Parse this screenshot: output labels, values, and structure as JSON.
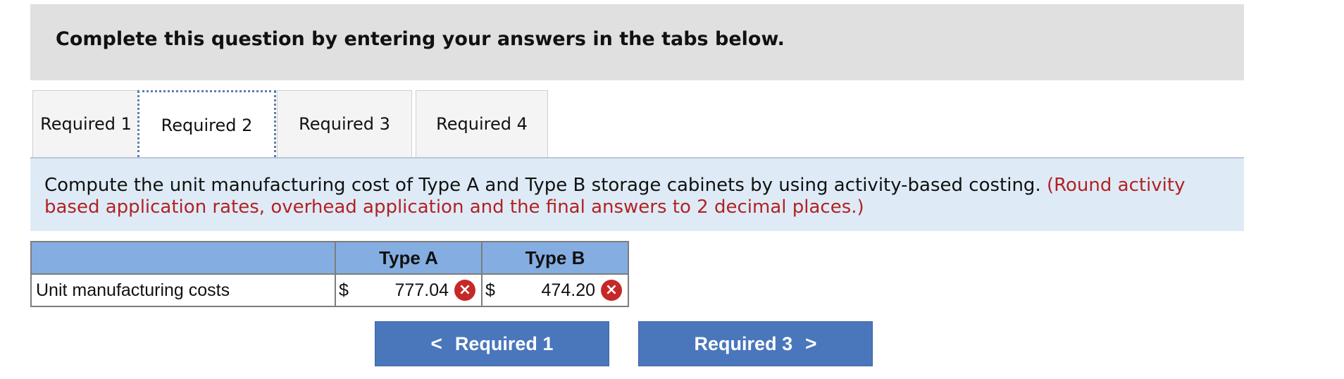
{
  "header": {
    "title": "Complete this question by entering your answers in the tabs below."
  },
  "tabs": [
    {
      "label": "Required 1",
      "active": false
    },
    {
      "label": "Required 2",
      "active": true
    },
    {
      "label": "Required 3",
      "active": false
    },
    {
      "label": "Required 4",
      "active": false
    }
  ],
  "instructions": {
    "text": "Compute the unit manufacturing cost of Type A and Type B storage cabinets by using activity-based costing.",
    "hint": "(Round activity based application rates, overhead application and the final answers to 2 decimal places.)"
  },
  "table": {
    "columns": [
      "Type A",
      "Type B"
    ],
    "row": {
      "label": "Unit manufacturing costs",
      "currency": "$",
      "type_a": "777.04",
      "type_b": "474.20"
    }
  },
  "nav": {
    "prev_label": "Required 1",
    "next_label": "Required 3",
    "prev_chevron": "<",
    "next_chevron": ">"
  },
  "status": {
    "incorrect_icon": "×"
  },
  "colors": {
    "header_bg": "#e0e0e0",
    "instruction_bg": "#deebf7",
    "hint": "#b22222",
    "table_header": "#84aee2",
    "button": "#4a76bb",
    "incorrect": "#c62828"
  }
}
